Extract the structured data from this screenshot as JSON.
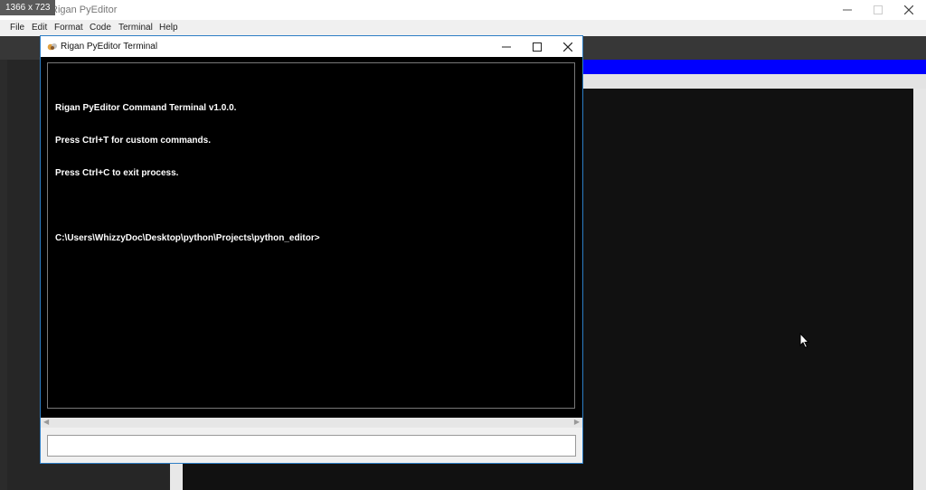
{
  "screen_size_badge": "1366 x 723",
  "main_window": {
    "title": "Rigan PyEditor",
    "menu": [
      "File",
      "Edit",
      "Format",
      "Code",
      "Terminal",
      "Help"
    ]
  },
  "terminal": {
    "title": "Rigan PyEditor Terminal",
    "lines": [
      "Rigan PyEditor Command Terminal v1.0.0.",
      "Press Ctrl+T for custom commands.",
      "Press Ctrl+C to exit process."
    ],
    "prompt": "C:\\Users\\WhizzyDoc\\Desktop\\python\\Projects\\python_editor>",
    "input_value": ""
  },
  "colors": {
    "accent_blue": "#0000ff",
    "terminal_bg": "#000000",
    "terminal_text": "#ffffff",
    "window_border": "#2d7ec5"
  }
}
